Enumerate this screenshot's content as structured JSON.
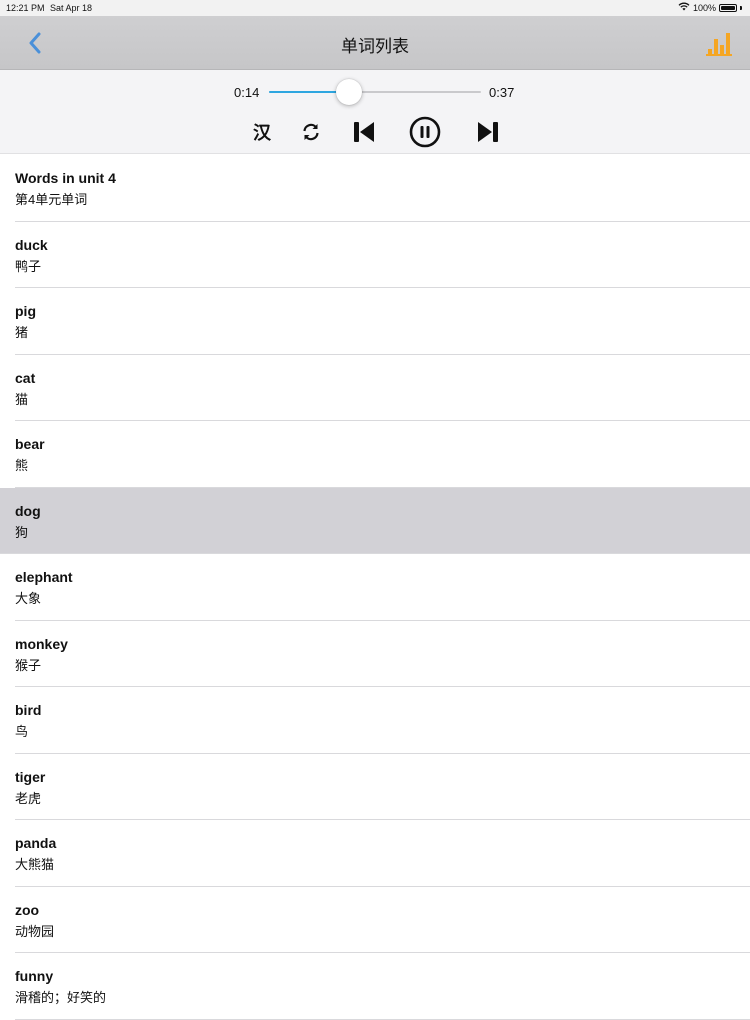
{
  "status": {
    "time": "12:21 PM",
    "date": "Sat Apr 18",
    "battery": "100%"
  },
  "nav": {
    "title": "单词列表",
    "back_icon": "chevron-left-icon",
    "stats_icon": "bar-chart-icon",
    "accent_color": "#4a90d9",
    "stats_color": "#f5a623"
  },
  "player": {
    "current_time": "0:14",
    "total_time": "0:37",
    "progress": 0.378,
    "language_toggle": "汉",
    "track_color": "#2ea6e0"
  },
  "words": [
    {
      "en": "Words in unit 4",
      "zh": "第4单元单词"
    },
    {
      "en": "duck",
      "zh": "鸭子"
    },
    {
      "en": "pig",
      "zh": "猪"
    },
    {
      "en": "cat",
      "zh": "猫"
    },
    {
      "en": "bear",
      "zh": "熊"
    },
    {
      "en": "dog",
      "zh": "狗"
    },
    {
      "en": "elephant",
      "zh": "大象"
    },
    {
      "en": "monkey",
      "zh": "猴子"
    },
    {
      "en": "bird",
      "zh": "鸟"
    },
    {
      "en": "tiger",
      "zh": "老虎"
    },
    {
      "en": "panda",
      "zh": "大熊猫"
    },
    {
      "en": "zoo",
      "zh": "动物园"
    },
    {
      "en": "funny",
      "zh": "滑稽的；好笑的"
    }
  ],
  "selected_index": 5
}
